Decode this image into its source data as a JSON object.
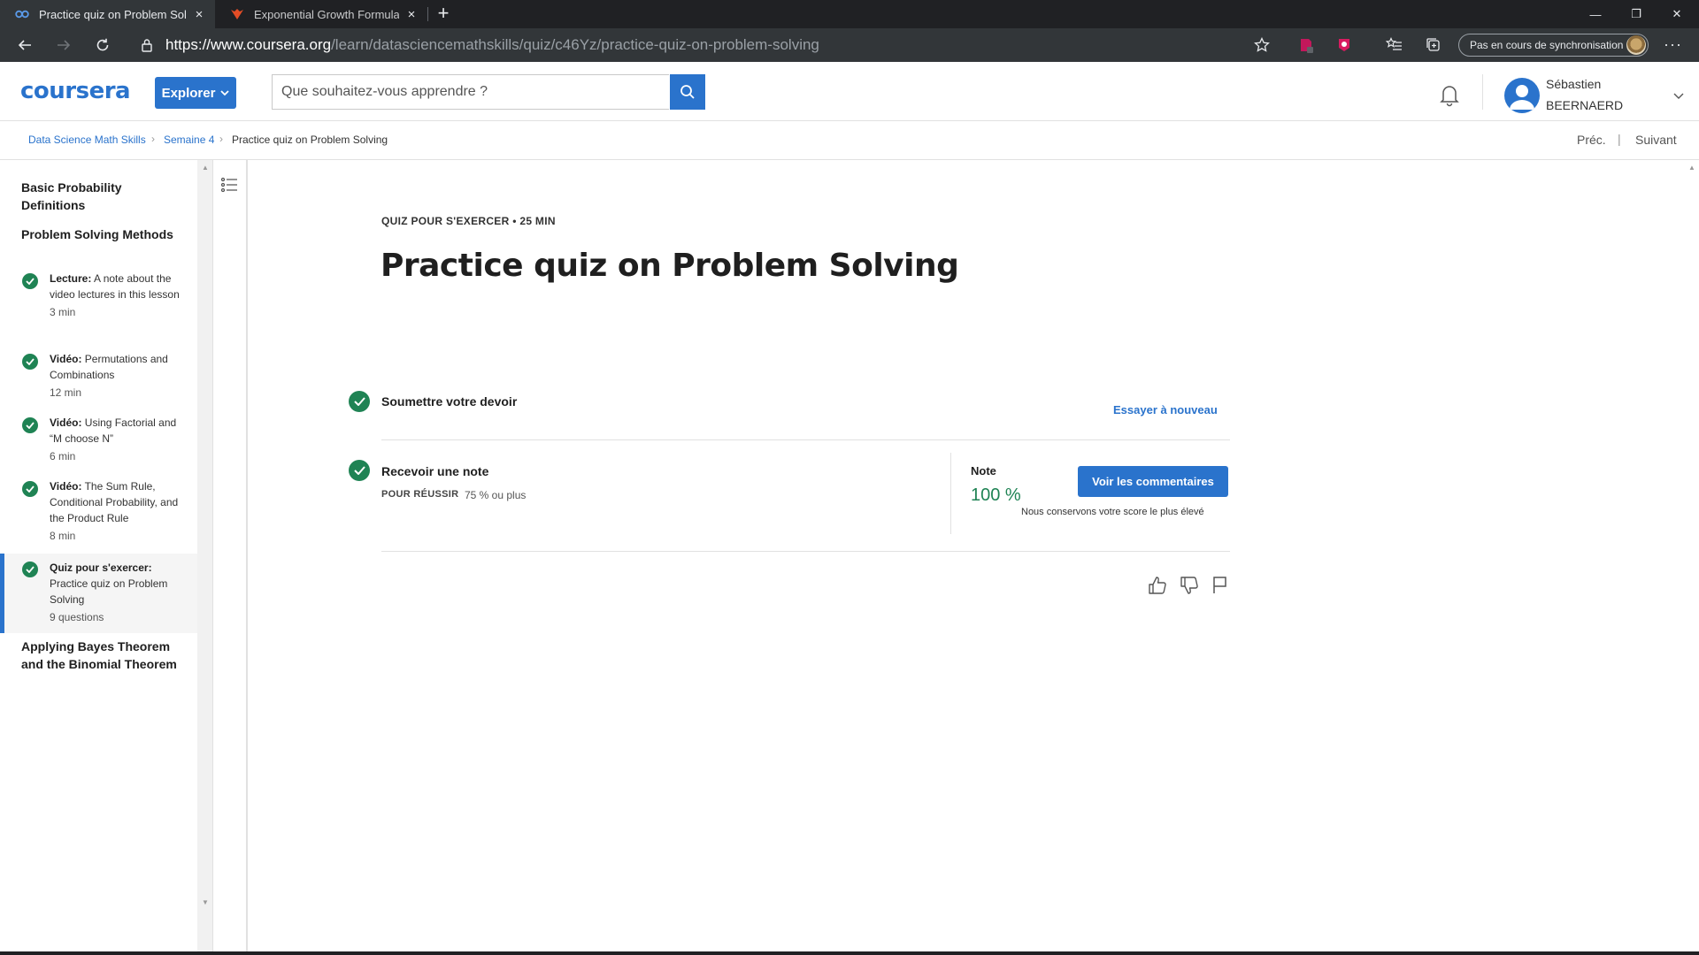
{
  "browser": {
    "tabs": [
      {
        "title": "Practice quiz on Problem Solving",
        "close": "×"
      },
      {
        "title": "Exponential Growth Formula | St",
        "close": "×"
      }
    ],
    "new_tab": "+",
    "url_host": "https://www.coursera.org",
    "url_path": "/learn/datasciencemathskills/quiz/c46Yz/practice-quiz-on-problem-solving",
    "sync_label": "Pas en cours de synchronisation",
    "more": "···",
    "window_controls": {
      "minimize": "—",
      "restore": "❐",
      "close": "✕"
    }
  },
  "header": {
    "logo": "coursera",
    "explore_label": "Explorer",
    "search_placeholder": "Que souhaitez-vous apprendre ?",
    "user_first": "Sébastien",
    "user_last": "BEERNAERD"
  },
  "breadcrumb": {
    "items": [
      "Data Science Math Skills",
      "Semaine 4",
      "Practice quiz on Problem Solving"
    ],
    "prev": "Préc.",
    "divider": "|",
    "next": "Suivant"
  },
  "sidebar": {
    "lessons": [
      {
        "title": "Basic Probability Definitions"
      },
      {
        "title": "Problem Solving Methods"
      },
      {
        "title": "Applying Bayes Theorem and the Binomial Theorem"
      }
    ],
    "items": [
      {
        "type": "Lecture:",
        "name": "A note about the video lectures in this lesson",
        "meta": "3  min"
      },
      {
        "type": "Vidéo:",
        "name": "Permutations and Combinations",
        "meta": "12  min"
      },
      {
        "type": "Vidéo:",
        "name": "Using Factorial and “M choose N”",
        "meta": "6  min"
      },
      {
        "type": "Vidéo:",
        "name": "The Sum Rule, Conditional Probability, and the Product Rule",
        "meta": "8  min"
      },
      {
        "type": "Quiz pour s'exercer:",
        "name": "Practice quiz on Problem Solving",
        "meta": "9 questions"
      }
    ]
  },
  "quiz": {
    "eyebrow": "QUIZ POUR S'EXERCER • 25  MIN",
    "title": "Practice quiz on Problem Solving",
    "submit_label": "Soumettre votre devoir",
    "retry_label": "Essayer à nouveau",
    "receive_label": "Recevoir une note",
    "pass_label": "POUR RÉUSSIR",
    "pass_value": "75 % ou plus",
    "grade_label": "Note",
    "grade_value": "100 %",
    "feedback_label": "Voir les commentaires",
    "keep_note": "Nous conservons votre score le plus élevé"
  },
  "colors": {
    "brand": "#2a73cc",
    "success": "#1f8354",
    "chrome_dark": "#202124"
  }
}
